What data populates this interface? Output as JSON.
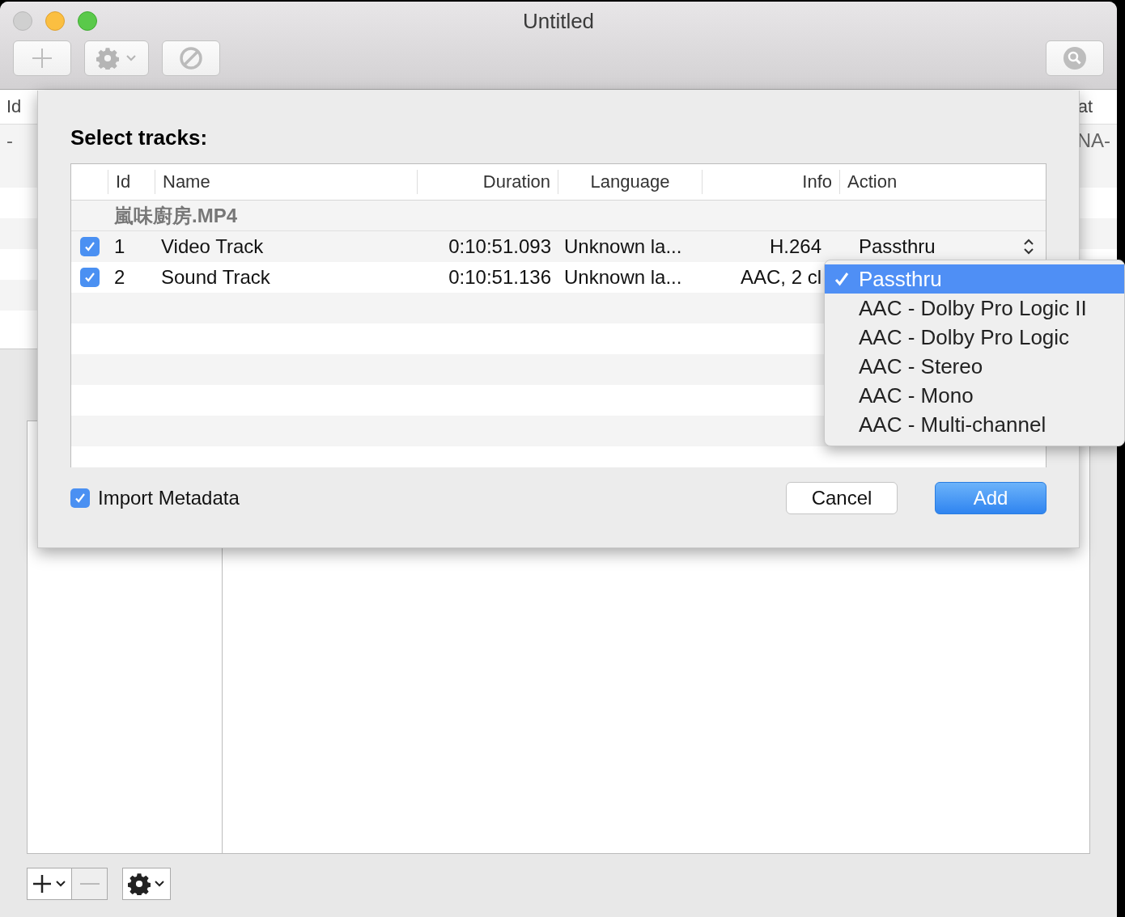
{
  "window": {
    "title": "Untitled"
  },
  "background_table": {
    "columns": [
      "Id",
      "at"
    ],
    "rows": [
      [
        "-",
        "NA-"
      ]
    ]
  },
  "sheet": {
    "title": "Select tracks:",
    "columns": [
      "Id",
      "Name",
      "Duration",
      "Language",
      "Info",
      "Action"
    ],
    "group": "嵐味廚房.MP4",
    "tracks": [
      {
        "checked": true,
        "id": "1",
        "name": "Video Track",
        "duration": "0:10:51.093",
        "language": "Unknown la...",
        "info": "H.264",
        "action": "Passthru"
      },
      {
        "checked": true,
        "id": "2",
        "name": "Sound Track",
        "duration": "0:10:51.136",
        "language": "Unknown la...",
        "info": "AAC, 2 cl"
      }
    ],
    "import_metadata": {
      "label": "Import Metadata",
      "checked": true
    },
    "buttons": [
      {
        "label": "Cancel",
        "kind": "normal"
      },
      {
        "label": "Add",
        "kind": "default"
      }
    ]
  },
  "menu": {
    "items": [
      {
        "label": "Passthru",
        "selected": true
      },
      {
        "label": "AAC - Dolby Pro Logic II",
        "selected": false
      },
      {
        "label": "AAC - Dolby Pro Logic",
        "selected": false
      },
      {
        "label": "AAC - Stereo",
        "selected": false
      },
      {
        "label": "AAC - Mono",
        "selected": false
      },
      {
        "label": "AAC - Multi-channel",
        "selected": false
      }
    ]
  }
}
